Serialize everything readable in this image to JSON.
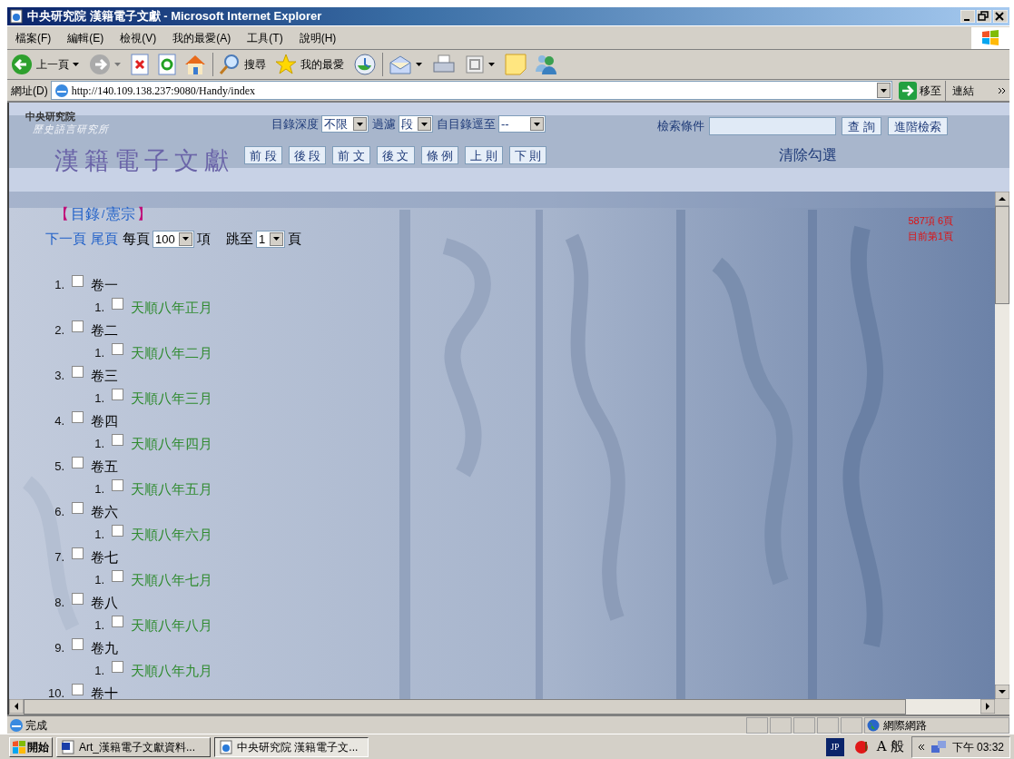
{
  "window": {
    "title": "中央研究院 漢籍電子文獻 - Microsoft Internet Explorer"
  },
  "menu": [
    "檔案(F)",
    "編輯(E)",
    "檢視(V)",
    "我的最愛(A)",
    "工具(T)",
    "說明(H)"
  ],
  "toolbar": {
    "back": "上一頁",
    "search": "搜尋",
    "favorites": "我的最愛"
  },
  "address": {
    "label": "網址(D)",
    "url": "http://140.109.138.237:9080/Handy/index",
    "go": "移至",
    "links": "連結"
  },
  "header": {
    "org": "中央研究院",
    "institute": "歷史語言研究所",
    "site": "漢籍電子文獻",
    "filters": [
      {
        "label": "目錄深度",
        "value": "不限"
      },
      {
        "label": "過濾",
        "value": "段"
      },
      {
        "label": "自目錄逕至",
        "value": "--"
      }
    ],
    "search_label": "檢索條件",
    "search_buttons": [
      "查 詢",
      "進階檢索"
    ],
    "nav_buttons": [
      "前 段",
      "後 段",
      "前 文",
      "後 文",
      "條 例",
      "上 則",
      "下 則"
    ],
    "clear": "清除勾選"
  },
  "breadcrumb": {
    "open": "【",
    "path": "目錄",
    "sep": "/",
    "current": "憲宗",
    "close": "】"
  },
  "paging": {
    "next": "下一頁",
    "last": "尾頁",
    "per_page_label": "每頁",
    "per_page": "100",
    "unit": "項",
    "jump_label": "跳至",
    "jump": "1",
    "page_unit": "頁"
  },
  "summary": [
    "587項 6頁",
    "目前第1頁"
  ],
  "tree": [
    {
      "num": "1.",
      "label": "卷一",
      "checked": false,
      "children": [
        {
          "num": "1.",
          "label": "天順八年正月",
          "checked": false
        }
      ]
    },
    {
      "num": "2.",
      "label": "卷二",
      "checked": false,
      "children": [
        {
          "num": "1.",
          "label": "天順八年二月",
          "checked": false
        }
      ]
    },
    {
      "num": "3.",
      "label": "卷三",
      "checked": false,
      "children": [
        {
          "num": "1.",
          "label": "天順八年三月",
          "checked": false
        }
      ]
    },
    {
      "num": "4.",
      "label": "卷四",
      "checked": false,
      "children": [
        {
          "num": "1.",
          "label": "天順八年四月",
          "checked": false
        }
      ]
    },
    {
      "num": "5.",
      "label": "卷五",
      "checked": false,
      "children": [
        {
          "num": "1.",
          "label": "天順八年五月",
          "checked": false
        }
      ]
    },
    {
      "num": "6.",
      "label": "卷六",
      "checked": false,
      "children": [
        {
          "num": "1.",
          "label": "天順八年六月",
          "checked": false
        }
      ]
    },
    {
      "num": "7.",
      "label": "卷七",
      "checked": false,
      "children": [
        {
          "num": "1.",
          "label": "天順八年七月",
          "checked": false
        }
      ]
    },
    {
      "num": "8.",
      "label": "卷八",
      "checked": false,
      "children": [
        {
          "num": "1.",
          "label": "天順八年八月",
          "checked": false
        }
      ]
    },
    {
      "num": "9.",
      "label": "卷九",
      "checked": false,
      "children": [
        {
          "num": "1.",
          "label": "天順八年九月",
          "checked": false
        }
      ]
    },
    {
      "num": "10.",
      "label": "卷十",
      "checked": false
    }
  ],
  "status": {
    "text": "完成",
    "zone": "網際網路"
  },
  "taskbar": {
    "start": "開始",
    "tasks": [
      {
        "label": "Art_漢籍電子文獻資料...",
        "selected": false
      },
      {
        "label": "中央研究院 漢籍電子文...",
        "selected": true
      }
    ],
    "ime": [
      "JP",
      "A",
      "般"
    ],
    "clock": "下午 03:32"
  }
}
